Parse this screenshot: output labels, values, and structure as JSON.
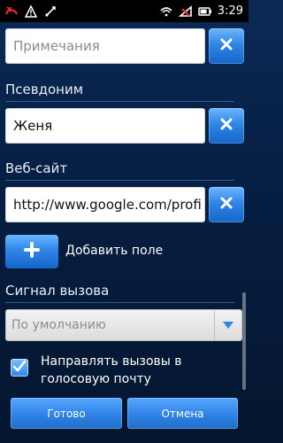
{
  "status_bar": {
    "time": "3:29",
    "icons": [
      "missed-call-icon",
      "warning-icon",
      "usb-icon",
      "wifi-icon",
      "no-sim-icon",
      "battery-icon"
    ]
  },
  "notes": {
    "placeholder": "Примечания"
  },
  "nickname": {
    "label": "Псевдоним",
    "value": "Женя"
  },
  "website": {
    "label": "Веб-сайт",
    "value": "http://www.google.com/profi"
  },
  "add_field": {
    "label": "Добавить поле"
  },
  "ringtone": {
    "label": "Сигнал вызова",
    "selected": "По умолчанию"
  },
  "voicemail": {
    "label": "Направлять вызовы в голосовую почту",
    "checked": true
  },
  "actions": {
    "done": "Готово",
    "cancel": "Отмена"
  },
  "colors": {
    "accent": "#2f86e6",
    "background": "#0a2a55"
  }
}
